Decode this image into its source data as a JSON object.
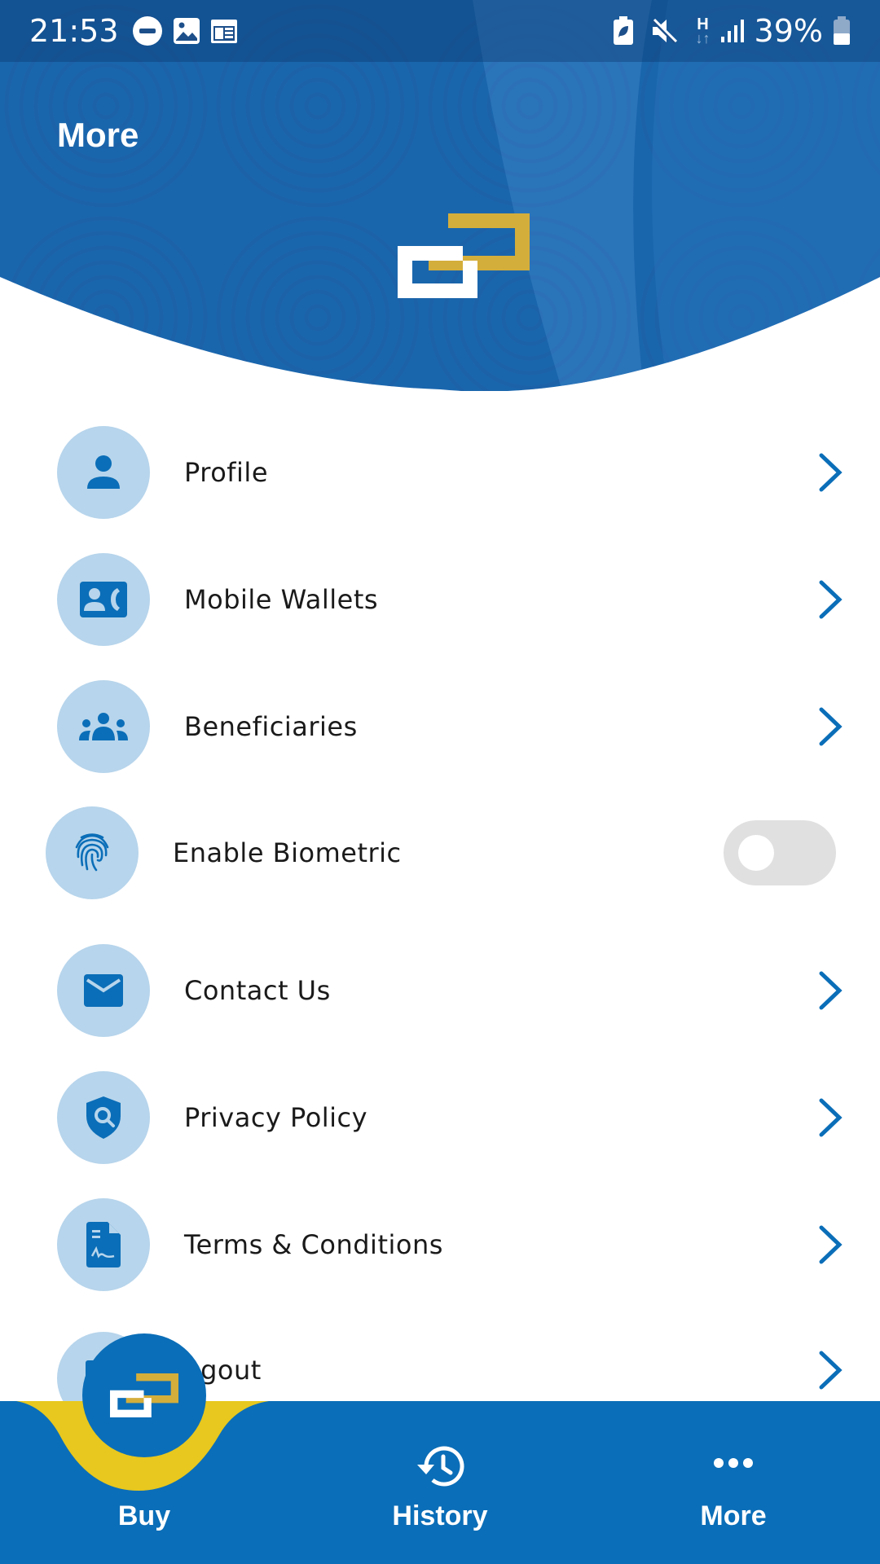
{
  "status_bar": {
    "time": "21:53",
    "left_icons": [
      "do-not-disturb-icon",
      "gallery-icon",
      "calendar-icon"
    ],
    "right_icons": [
      "battery-saver-icon",
      "mute-icon",
      "network-h-icon",
      "signal-icon"
    ],
    "network_type": "H",
    "battery_percent": "39%"
  },
  "header": {
    "title": "More",
    "logo": "app-logo"
  },
  "colors": {
    "primary": "#0b6eb8",
    "header_blue": "#1a66ad",
    "accent_gold": "#d4ae3b",
    "accent_yellow": "#e8c81e",
    "icon_bg": "#b7d5ec",
    "toggle_off": "#e0e0e0"
  },
  "menu": {
    "items": [
      {
        "label": "Profile",
        "icon": "person-icon",
        "control": "chevron"
      },
      {
        "label": "Mobile Wallets",
        "icon": "contact-phone-icon",
        "control": "chevron"
      },
      {
        "label": "Beneficiaries",
        "icon": "group-icon",
        "control": "chevron"
      },
      {
        "label": "Enable Biometric",
        "icon": "fingerprint-icon",
        "control": "toggle",
        "enabled": false
      },
      {
        "label": "Contact Us",
        "icon": "mail-icon",
        "control": "chevron"
      },
      {
        "label": "Privacy Policy",
        "icon": "shield-search-icon",
        "control": "chevron"
      },
      {
        "label": "Terms & Conditions",
        "icon": "document-signature-icon",
        "control": "chevron"
      },
      {
        "label": "Logout",
        "visible_label": "ogout",
        "icon": "logout-icon",
        "control": "chevron"
      }
    ]
  },
  "bottom_nav": {
    "items": [
      {
        "label": "Buy",
        "icon": "app-logo"
      },
      {
        "label": "History",
        "icon": "history-icon"
      },
      {
        "label": "More",
        "icon": "more-horizontal-icon",
        "active": true
      }
    ]
  }
}
